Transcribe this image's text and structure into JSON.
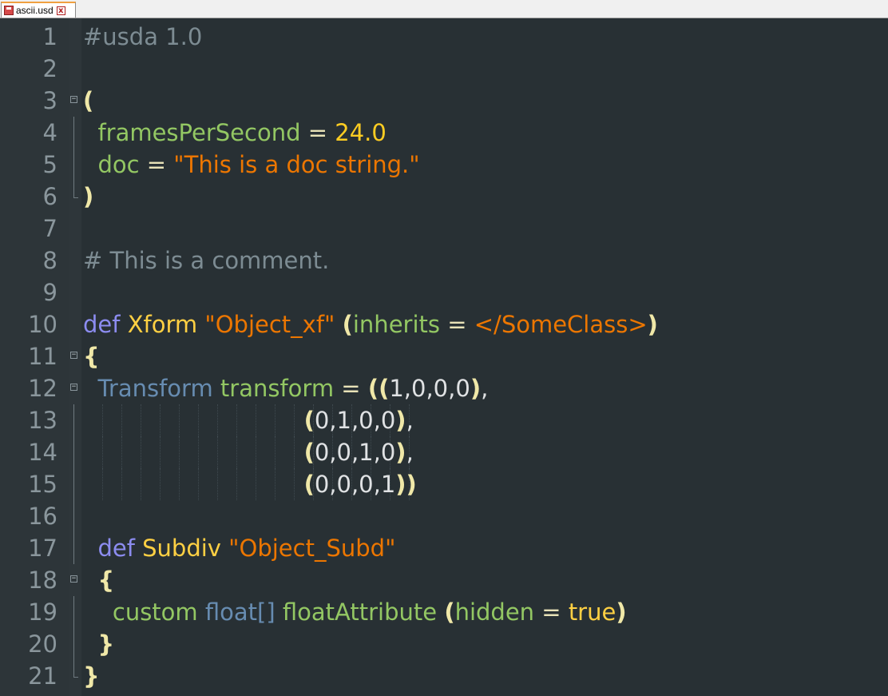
{
  "tab": {
    "filename": "ascii.usd",
    "close_glyph": "x"
  },
  "colors": {
    "background": "#283034",
    "gutter": "#2d3539",
    "comment": "#7d8c93",
    "keyword": "#8c8cf0",
    "type": "#ffd043",
    "string": "#ec7600",
    "attribute": "#93c763",
    "number": "#ffcd22"
  },
  "lines": [
    {
      "n": "1",
      "tokens": [
        [
          "c-comment",
          "#usda 1.0"
        ]
      ]
    },
    {
      "n": "2",
      "tokens": []
    },
    {
      "n": "3",
      "tokens": [
        [
          "c-paren",
          "("
        ]
      ]
    },
    {
      "n": "4",
      "tokens": [
        [
          "c-text",
          "  "
        ],
        [
          "c-attr",
          "framesPerSecond"
        ],
        [
          "c-op",
          " = "
        ],
        [
          "c-num",
          "24.0"
        ]
      ]
    },
    {
      "n": "5",
      "tokens": [
        [
          "c-text",
          "  "
        ],
        [
          "c-attr",
          "doc"
        ],
        [
          "c-op",
          " = "
        ],
        [
          "c-str",
          "\"This is a doc string.\""
        ]
      ]
    },
    {
      "n": "6",
      "tokens": [
        [
          "c-paren",
          ")"
        ]
      ]
    },
    {
      "n": "7",
      "tokens": []
    },
    {
      "n": "8",
      "tokens": [
        [
          "c-comment",
          "# This is a comment."
        ]
      ]
    },
    {
      "n": "9",
      "tokens": []
    },
    {
      "n": "10",
      "tokens": [
        [
          "c-kw",
          "def"
        ],
        [
          "c-text",
          " "
        ],
        [
          "c-type",
          "Xform"
        ],
        [
          "c-text",
          " "
        ],
        [
          "c-str",
          "\"Object_xf\""
        ],
        [
          "c-text",
          " "
        ],
        [
          "c-paren",
          "("
        ],
        [
          "c-attr",
          "inherits"
        ],
        [
          "c-op",
          " = "
        ],
        [
          "c-str",
          "</SomeClass>"
        ],
        [
          "c-paren",
          ")"
        ]
      ]
    },
    {
      "n": "11",
      "tokens": [
        [
          "c-paren",
          "{"
        ]
      ]
    },
    {
      "n": "12",
      "tokens": [
        [
          "c-text",
          "  "
        ],
        [
          "c-blue",
          "Transform"
        ],
        [
          "c-text",
          " "
        ],
        [
          "c-attr",
          "transform"
        ],
        [
          "c-op",
          " = "
        ],
        [
          "c-paren",
          "(("
        ],
        [
          "c-text",
          "1,0,0,0"
        ],
        [
          "c-paren",
          ")"
        ],
        [
          "c-text",
          ","
        ]
      ]
    },
    {
      "n": "13",
      "tokens": [
        [
          "c-text",
          "                              "
        ],
        [
          "c-paren",
          "("
        ],
        [
          "c-text",
          "0,1,0,0"
        ],
        [
          "c-paren",
          ")"
        ],
        [
          "c-text",
          ","
        ]
      ]
    },
    {
      "n": "14",
      "tokens": [
        [
          "c-text",
          "                              "
        ],
        [
          "c-paren",
          "("
        ],
        [
          "c-text",
          "0,0,1,0"
        ],
        [
          "c-paren",
          ")"
        ],
        [
          "c-text",
          ","
        ]
      ]
    },
    {
      "n": "15",
      "tokens": [
        [
          "c-text",
          "                              "
        ],
        [
          "c-paren",
          "("
        ],
        [
          "c-text",
          "0,0,0,1"
        ],
        [
          "c-paren",
          "))"
        ]
      ]
    },
    {
      "n": "16",
      "tokens": []
    },
    {
      "n": "17",
      "tokens": [
        [
          "c-text",
          "  "
        ],
        [
          "c-kw",
          "def"
        ],
        [
          "c-text",
          " "
        ],
        [
          "c-type",
          "Subdiv"
        ],
        [
          "c-text",
          " "
        ],
        [
          "c-str",
          "\"Object_Subd\""
        ]
      ]
    },
    {
      "n": "18",
      "tokens": [
        [
          "c-text",
          "  "
        ],
        [
          "c-paren",
          "{"
        ]
      ]
    },
    {
      "n": "19",
      "tokens": [
        [
          "c-text",
          "    "
        ],
        [
          "c-attr",
          "custom"
        ],
        [
          "c-text",
          " "
        ],
        [
          "c-blue",
          "float[]"
        ],
        [
          "c-text",
          " "
        ],
        [
          "c-attr",
          "floatAttribute"
        ],
        [
          "c-text",
          " "
        ],
        [
          "c-paren",
          "("
        ],
        [
          "c-attr",
          "hidden"
        ],
        [
          "c-op",
          " = "
        ],
        [
          "c-type",
          "true"
        ],
        [
          "c-paren",
          ")"
        ]
      ]
    },
    {
      "n": "20",
      "tokens": [
        [
          "c-text",
          "  "
        ],
        [
          "c-paren",
          "}"
        ]
      ]
    },
    {
      "n": "21",
      "tokens": [
        [
          "c-paren",
          "}"
        ]
      ]
    }
  ]
}
